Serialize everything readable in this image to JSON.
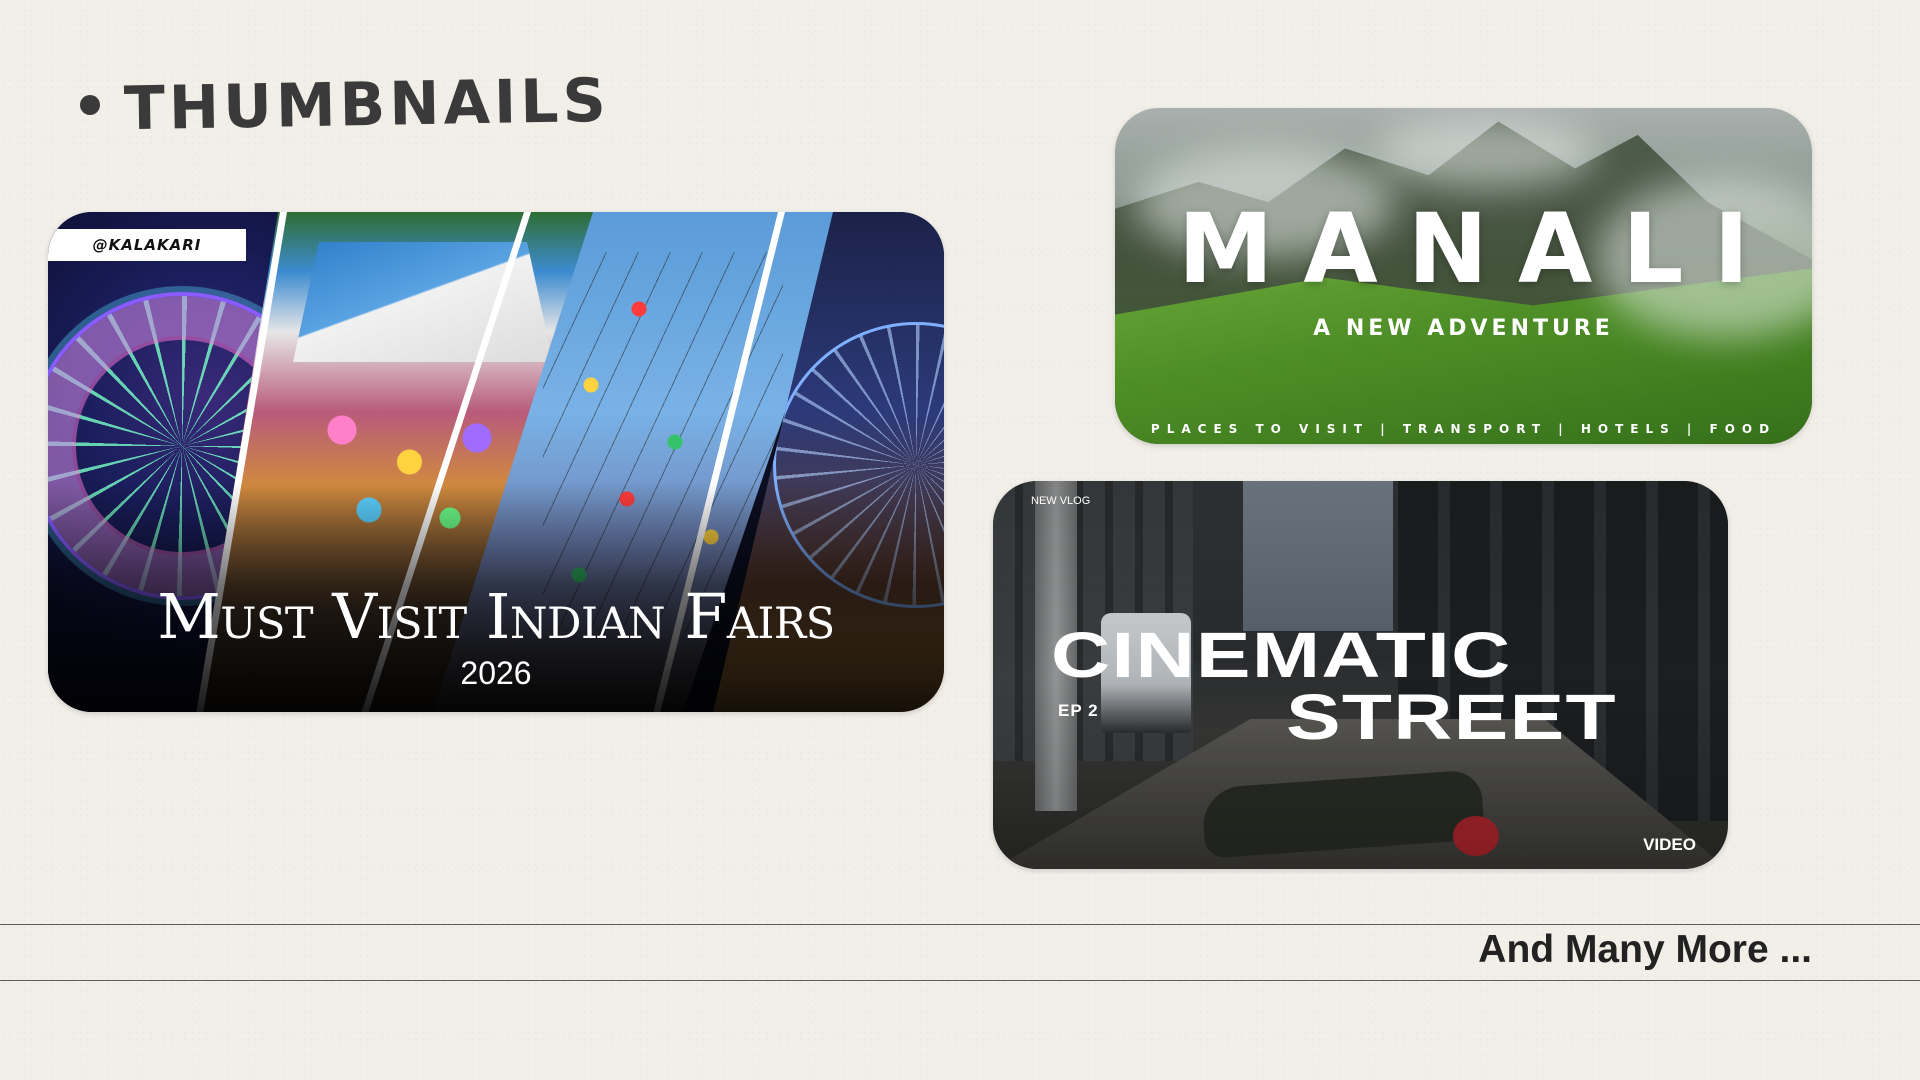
{
  "heading": {
    "title": "THUMBNAILS"
  },
  "thumbnails": [
    {
      "handle": "@KALAKARI",
      "title": "Must Visit Indian Fairs",
      "year": "2026"
    },
    {
      "title": "MANALI",
      "subtitle": "A NEW ADVENTURE",
      "footer": "PLACES TO VISIT | TRANSPORT | HOTELS | FOOD"
    },
    {
      "tag": "NEW VLOG",
      "title_line_1": "CINEMATIC",
      "title_line_2": "STREET",
      "episode": "EP 2",
      "label": "VIDEO"
    }
  ],
  "footer": {
    "text": "And Many More ..."
  },
  "colors": {
    "background": "#f2efe9",
    "text_dark": "#3a3a3a"
  }
}
